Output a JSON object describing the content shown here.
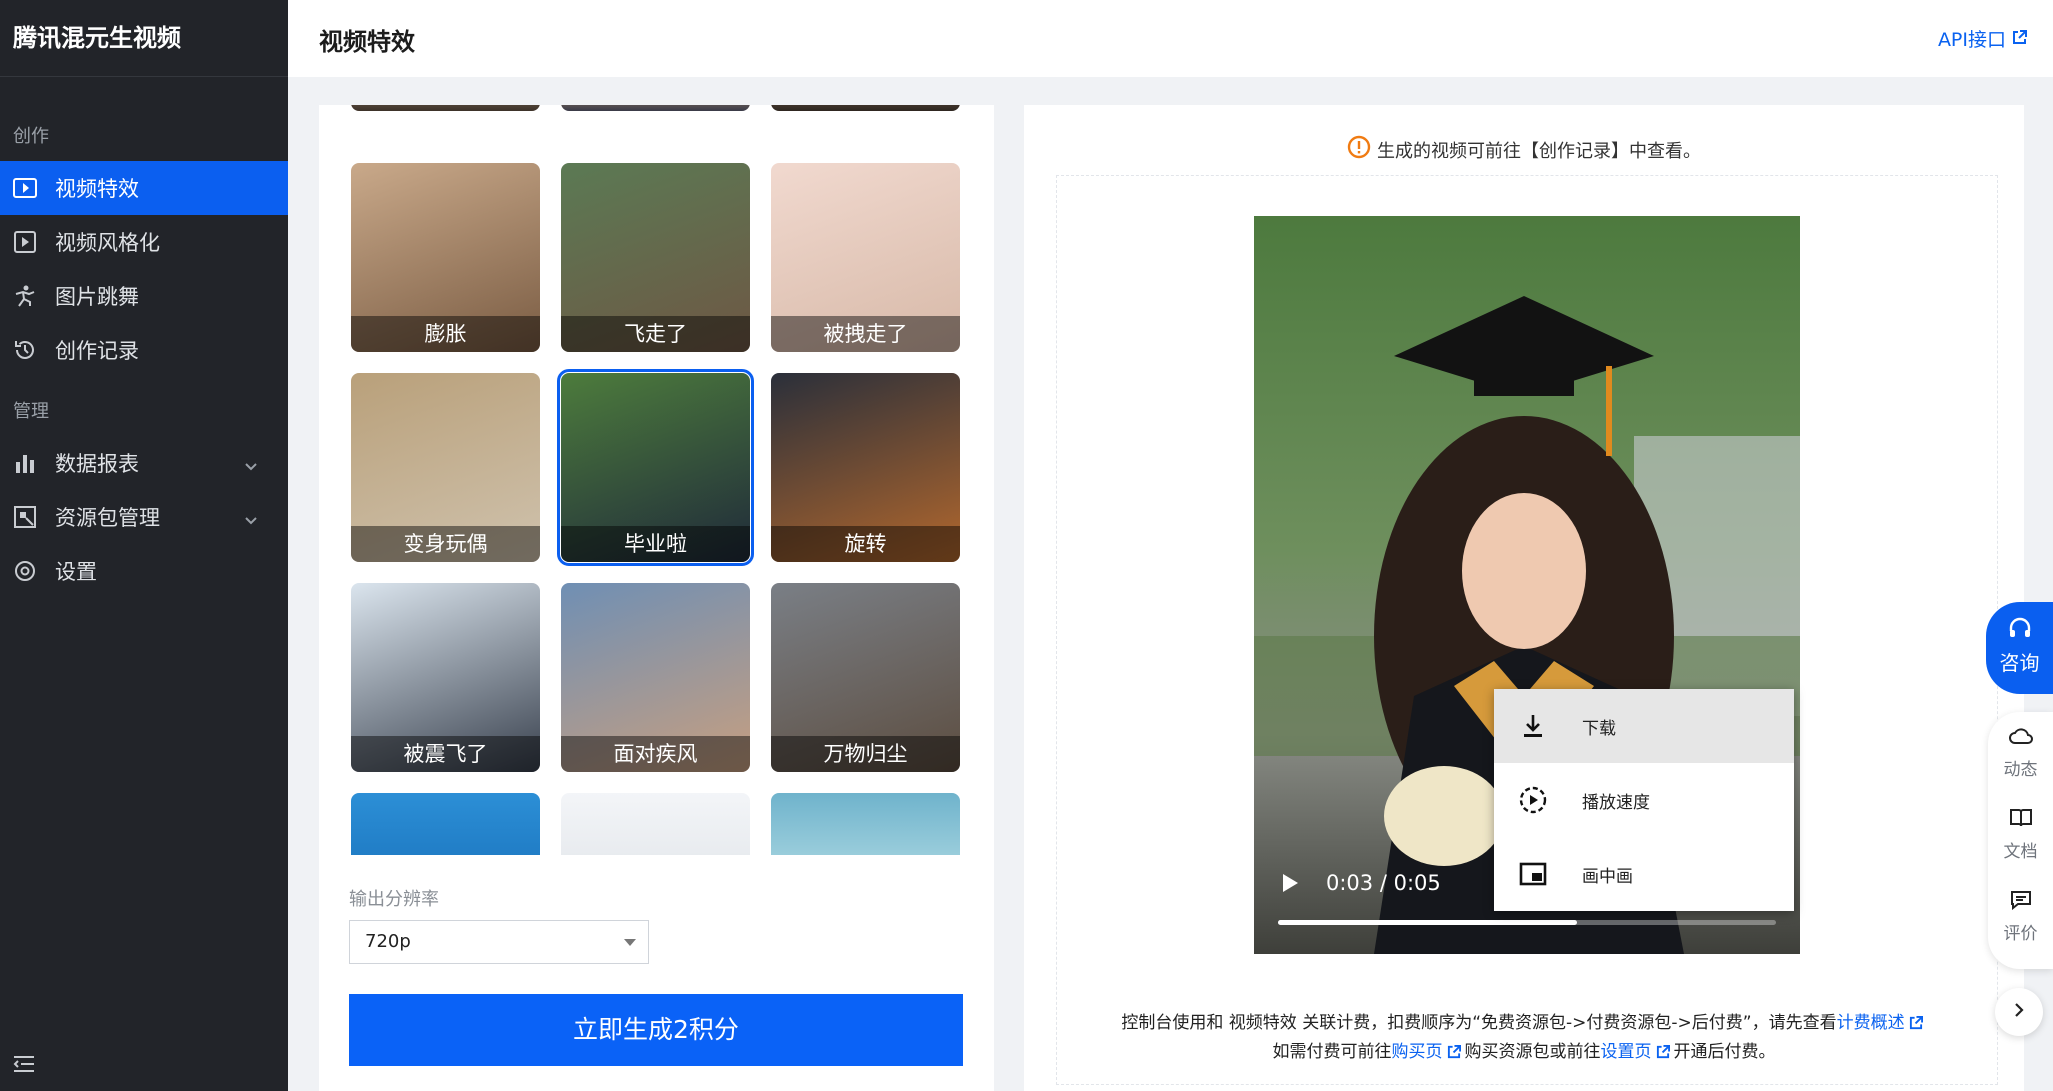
{
  "app": {
    "brand": "腾讯混元生视频"
  },
  "sidebar": {
    "groups": [
      {
        "label": "创作"
      },
      {
        "label": "管理"
      }
    ],
    "items": [
      {
        "label": "视频特效",
        "icon": "video-effect-icon",
        "active": true
      },
      {
        "label": "视频风格化",
        "icon": "video-play-icon"
      },
      {
        "label": "图片跳舞",
        "icon": "dance-icon"
      },
      {
        "label": "创作记录",
        "icon": "history-icon"
      },
      {
        "label": "数据报表",
        "icon": "bar-chart-icon",
        "expandable": true
      },
      {
        "label": "资源包管理",
        "icon": "package-icon",
        "expandable": true
      },
      {
        "label": "设置",
        "icon": "gear-icon"
      }
    ]
  },
  "header": {
    "title": "视频特效",
    "api_link": "API接口"
  },
  "effects": [
    {
      "label": "膨胀",
      "colors": [
        "#c9a98a",
        "#7a5c43"
      ]
    },
    {
      "label": "飞走了",
      "colors": [
        "#5b7a54",
        "#6e5744"
      ]
    },
    {
      "label": "被拽走了",
      "colors": [
        "#f1d9cf",
        "#d7b9a8"
      ]
    },
    {
      "label": "变身玩偶",
      "colors": [
        "#b9a07a",
        "#cfc2ad"
      ]
    },
    {
      "label": "毕业啦",
      "colors": [
        "#4d7c3c",
        "#1f2a3a"
      ],
      "selected": true
    },
    {
      "label": "旋转",
      "colors": [
        "#2a2f3a",
        "#b3682d"
      ]
    },
    {
      "label": "被震飞了",
      "colors": [
        "#dbe5ee",
        "#38404d"
      ]
    },
    {
      "label": "面对疾风",
      "colors": [
        "#6f8fb4",
        "#c79f80"
      ]
    },
    {
      "label": "万物归尘",
      "colors": [
        "#7a7f86",
        "#5c4d40"
      ]
    }
  ],
  "resolution": {
    "label": "输出分辨率",
    "value": "720p"
  },
  "generate_button": "立即生成2积分",
  "preview": {
    "tip": "生成的视频可前往【创作记录】中查看。",
    "video": {
      "time": "0:03 / 0:05",
      "progress": 0.6
    },
    "context_menu": [
      {
        "label": "下载",
        "icon": "download-icon"
      },
      {
        "label": "播放速度",
        "icon": "playback-speed-icon"
      },
      {
        "label": "画中画",
        "icon": "picture-in-picture-icon"
      }
    ]
  },
  "footer": {
    "line1_text": "控制台使用和 视频特效 关联计费，扣费顺序为“免费资源包->付费资源包->后付费”，请先查看",
    "line1_link": "计费概述",
    "line2_prefix": "如需付费可前往",
    "line2_link1": "购买页",
    "line2_mid": "购买资源包或前往",
    "line2_link2": "设置页",
    "line2_suffix": "开通后付费。"
  },
  "float_bar": {
    "consult": "咨询",
    "items": [
      {
        "label": "动态",
        "icon": "cloud-icon"
      },
      {
        "label": "文档",
        "icon": "book-icon"
      },
      {
        "label": "评价",
        "icon": "comment-icon"
      }
    ]
  },
  "colors": {
    "accent": "#0b5ff0",
    "sidebar_bg": "#222429"
  }
}
